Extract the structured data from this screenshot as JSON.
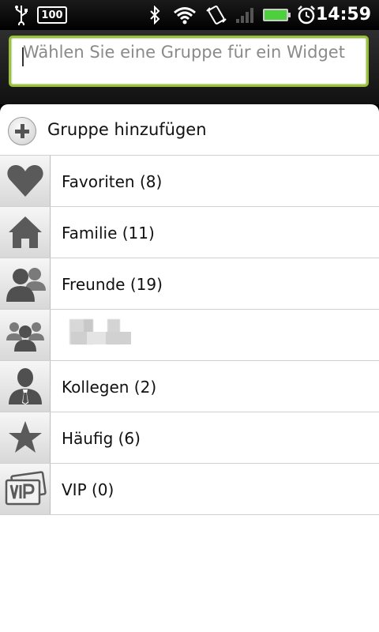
{
  "status_bar": {
    "battery_level": "100",
    "time": "14:59",
    "icons": [
      "usb-icon",
      "battery-percent-icon",
      "bluetooth-icon",
      "wifi-icon",
      "rotation-icon",
      "signal-icon",
      "battery-icon",
      "alarm-icon"
    ]
  },
  "search": {
    "placeholder": "Wählen Sie eine Gruppe für ein Widget"
  },
  "add_group": {
    "label": "Gruppe hinzufügen"
  },
  "groups": [
    {
      "label": "Favoriten (8)",
      "icon": "heart-icon"
    },
    {
      "label": "Familie (11)",
      "icon": "house-icon"
    },
    {
      "label": "Freunde (19)",
      "icon": "friends-icon"
    },
    {
      "label": "",
      "icon": "group-icon"
    },
    {
      "label": "Kollegen (2)",
      "icon": "colleague-icon"
    },
    {
      "label": "Häufig (6)",
      "icon": "star-icon"
    },
    {
      "label": "VIP (0)",
      "icon": "vip-icon"
    }
  ],
  "colors": {
    "accent_green": "#99c13a",
    "icon_gray": "#555555"
  }
}
